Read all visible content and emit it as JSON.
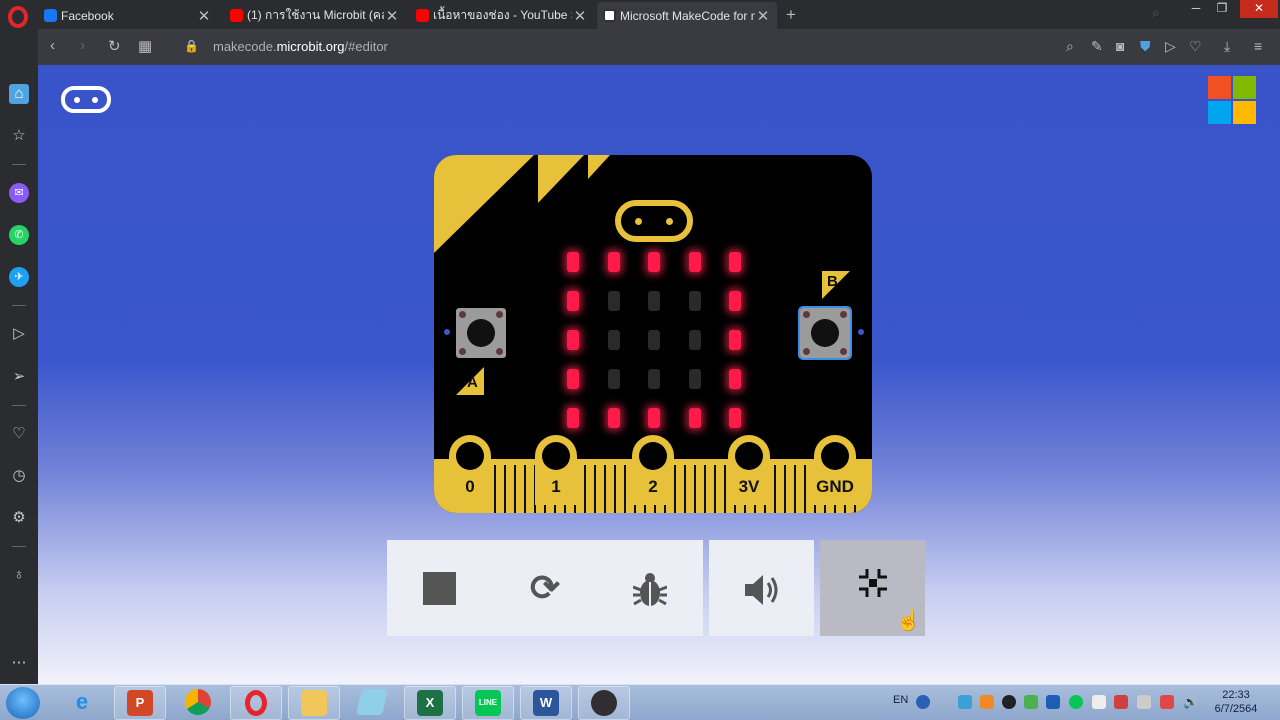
{
  "browser": {
    "tabs": [
      {
        "title": "Facebook",
        "color": "#1877f2"
      },
      {
        "title": "(1) การใช้งาน Microbit (คลา",
        "color": "#ff0000"
      },
      {
        "title": "เนื้อหาของช่อง - YouTube S",
        "color": "#ff0000"
      },
      {
        "title": "Microsoft MakeCode for m",
        "color": "#ffffff"
      }
    ],
    "active_tab": 3,
    "url_prefix": "makecode.",
    "url_host": "microbit.org",
    "url_path": "/#editor"
  },
  "simulator": {
    "led_grid": [
      [
        1,
        1,
        1,
        1,
        1
      ],
      [
        1,
        0,
        0,
        0,
        1
      ],
      [
        1,
        0,
        0,
        0,
        1
      ],
      [
        1,
        0,
        0,
        0,
        1
      ],
      [
        1,
        1,
        1,
        1,
        1
      ]
    ],
    "button_a_label": "A",
    "button_b_label": "B",
    "pins": [
      "0",
      "1",
      "2",
      "3V",
      "GND"
    ],
    "controls": {
      "stop": "stop-icon",
      "restart": "restart-icon",
      "debug": "bug-icon",
      "mute": "speaker-icon",
      "fullscreen": "fullscreen-icon"
    },
    "colors": {
      "board": "#000000",
      "accent": "#e8c13a",
      "led_on": "#ff1a4a",
      "background": "#3954c9"
    }
  },
  "taskbar": {
    "apps": [
      "ie",
      "powerpoint",
      "chrome",
      "opera",
      "explorer",
      "notepad",
      "excel",
      "line",
      "word",
      "obs"
    ],
    "language": "EN",
    "time": "22:33",
    "date": "6/7/2564"
  }
}
